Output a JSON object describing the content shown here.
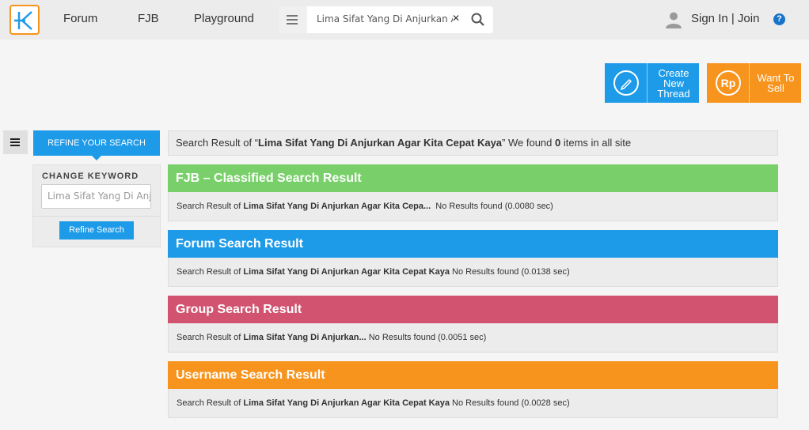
{
  "header": {
    "nav": [
      "Forum",
      "FJB",
      "Playground"
    ],
    "search_value": "Lima Sifat Yang Di Anjurkan Agar",
    "sign_in_label": "Sign In | Join",
    "help_label": "?"
  },
  "actions": {
    "create_thread_label": "Create New Thread",
    "create_line1": "Create",
    "create_line2": "New",
    "create_line3": "Thread",
    "sell_line1": "Want To",
    "sell_line2": "Sell",
    "sell_icon_text": "Rp"
  },
  "sidebar": {
    "refine_tab_label": "REFINE YOUR SEARCH",
    "change_keyword_label": "CHANGE KEYWORD",
    "keyword_value": "Lima Sifat Yang Di Anjurkan",
    "refine_button_label": "Refine Search"
  },
  "summary": {
    "prefix": "Search Result of “",
    "keyword": "Lima Sifat Yang Di Anjurkan Agar Kita Cepat Kaya",
    "middle": "” We found ",
    "count": "0",
    "suffix": " items in all site"
  },
  "sections": [
    {
      "title": "FJB – Classified Search Result",
      "color": "#79d06a",
      "prefix": "Search Result of ",
      "keyword": "Lima Sifat Yang Di Anjurkan Agar Kita Cepa...",
      "result": "No Results found (0.0080 sec)"
    },
    {
      "title": "Forum Search Result",
      "color": "#1e9be8",
      "prefix": "Search Result of ",
      "keyword": "Lima Sifat Yang Di Anjurkan Agar Kita Cepat Kaya",
      "result": "No Results found (0.0138 sec)"
    },
    {
      "title": "Group Search Result",
      "color": "#d1536f",
      "prefix": "Search Result of ",
      "keyword": "Lima Sifat Yang Di Anjurkan...",
      "result": "No Results found (0.0051 sec)"
    },
    {
      "title": "Username Search Result",
      "color": "#f7941d",
      "prefix": "Search Result of ",
      "keyword": "Lima Sifat Yang Di Anjurkan Agar Kita Cepat Kaya",
      "result": "No Results found (0.0028 sec)"
    }
  ],
  "colors": {
    "brand_blue": "#1e9be8",
    "brand_orange": "#f7941d"
  },
  "icons": [
    "kaskus-logo-icon",
    "menu-icon",
    "close-icon",
    "search-icon",
    "user-icon",
    "help-icon",
    "pencil-icon",
    "rupiah-icon"
  ]
}
